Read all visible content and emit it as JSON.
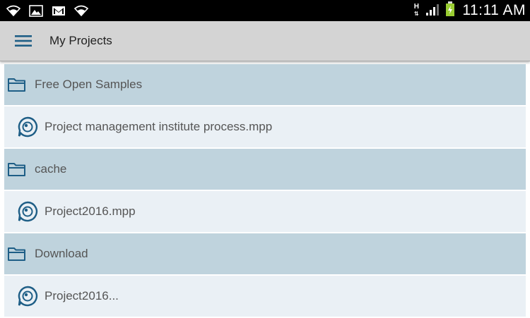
{
  "statusbar": {
    "left_icons": [
      "wifi-icon",
      "image-icon",
      "gmail-icon",
      "wifi-icon"
    ],
    "network_type": "H",
    "time": "11:11 AM"
  },
  "appbar": {
    "title": "My Projects",
    "menu_icon": "menu-icon"
  },
  "items": [
    {
      "type": "folder",
      "label": "Free Open Samples"
    },
    {
      "type": "file",
      "label": "Project management institute process.mpp"
    },
    {
      "type": "folder",
      "label": "cache"
    },
    {
      "type": "file",
      "label": "Project2016.mpp"
    },
    {
      "type": "folder",
      "label": "Download"
    },
    {
      "type": "file",
      "label": "Project2016..."
    }
  ],
  "colors": {
    "folder_row": "#bfd3dd",
    "file_row": "#eaf0f5",
    "icon_blue": "#1e5e86",
    "appbar": "#d4d4d4"
  }
}
